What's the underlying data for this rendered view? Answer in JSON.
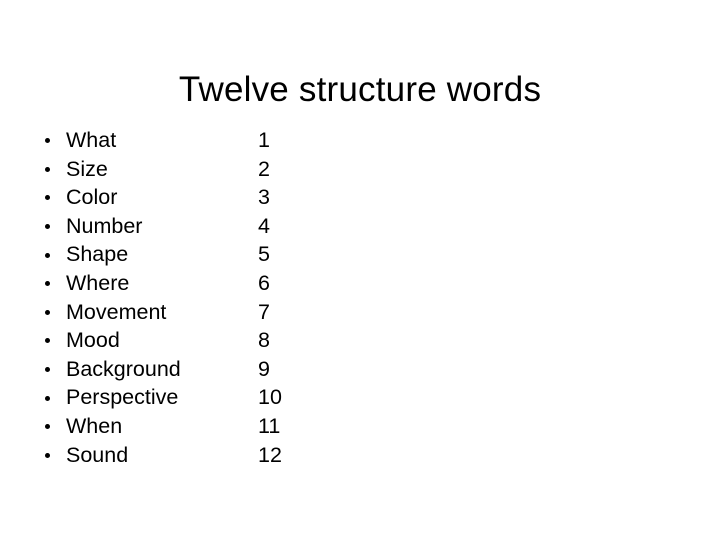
{
  "slide": {
    "title": "Twelve structure words",
    "background_color": "#ffffff",
    "text_color": "#000000",
    "items": [
      {
        "label": "What",
        "number": "1"
      },
      {
        "label": "Size",
        "number": "2"
      },
      {
        "label": "Color",
        "number": "3"
      },
      {
        "label": "Number",
        "number": "4"
      },
      {
        "label": "Shape",
        "number": "5"
      },
      {
        "label": "Where",
        "number": "6"
      },
      {
        "label": "Movement",
        "number": "7"
      },
      {
        "label": "Mood",
        "number": "8"
      },
      {
        "label": "Background",
        "number": "9"
      },
      {
        "label": "Perspective",
        "number": "10"
      },
      {
        "label": "When",
        "number": "11"
      },
      {
        "label": "Sound",
        "number": "12"
      }
    ]
  }
}
